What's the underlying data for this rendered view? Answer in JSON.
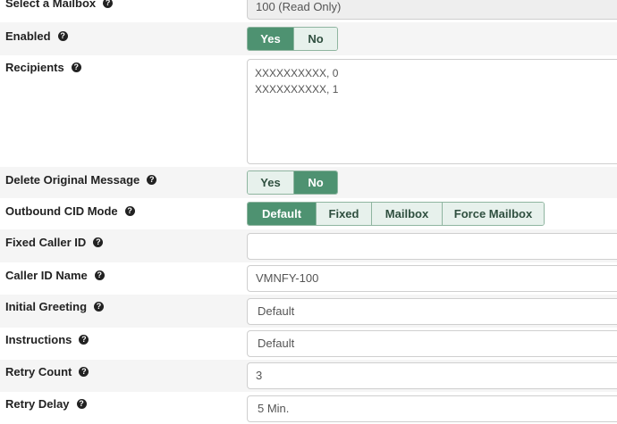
{
  "fields": {
    "mailbox": {
      "label": "Select a Mailbox",
      "value": "100 (Read Only)"
    },
    "enabled": {
      "label": "Enabled",
      "options": [
        "Yes",
        "No"
      ],
      "selected": "Yes"
    },
    "recipients": {
      "label": "Recipients",
      "lines": [
        "XXXXXXXXXX, 0",
        "XXXXXXXXXX, 1"
      ]
    },
    "delete_original": {
      "label": "Delete Original Message",
      "options": [
        "Yes",
        "No"
      ],
      "selected": "No"
    },
    "outbound_cid_mode": {
      "label": "Outbound CID Mode",
      "options": [
        "Default",
        "Fixed",
        "Mailbox",
        "Force Mailbox"
      ],
      "selected": "Default"
    },
    "fixed_caller_id": {
      "label": "Fixed Caller ID",
      "value": ""
    },
    "caller_id_name": {
      "label": "Caller ID Name",
      "value": "VMNFY-100"
    },
    "initial_greeting": {
      "label": "Initial Greeting",
      "value": "Default"
    },
    "instructions": {
      "label": "Instructions",
      "value": "Default"
    },
    "retry_count": {
      "label": "Retry Count",
      "value": "3"
    },
    "retry_delay": {
      "label": "Retry Delay",
      "value": "5 Min."
    }
  },
  "help_glyph": "?",
  "colors": {
    "active_button": "#4e9271",
    "inactive_button": "#e7f1ec",
    "button_border": "#8fb5a0"
  }
}
